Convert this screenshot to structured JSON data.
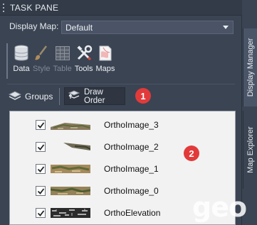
{
  "pane": {
    "title": "TASK PANE"
  },
  "display_map": {
    "label": "Display Map:",
    "value": "Default"
  },
  "toolbar": {
    "items": [
      {
        "label": "Data",
        "icon": "database-icon",
        "enabled": true
      },
      {
        "label": "Style",
        "icon": "paintbrush-icon",
        "enabled": false
      },
      {
        "label": "Table",
        "icon": "table-icon",
        "enabled": false
      },
      {
        "label": "Tools",
        "icon": "tools-icon",
        "enabled": true
      },
      {
        "label": "Maps",
        "icon": "maps-icon",
        "enabled": true
      }
    ]
  },
  "view_buttons": {
    "groups": "Groups",
    "draw_order": "Draw Order"
  },
  "callouts": {
    "one": "1",
    "two": "2"
  },
  "layers": [
    {
      "label": "OrthoImage_3",
      "checked": true
    },
    {
      "label": "OrthoImage_2",
      "checked": true
    },
    {
      "label": "OrthoImage_1",
      "checked": true
    },
    {
      "label": "OrthoImage_0",
      "checked": true
    },
    {
      "label": "OrthoElevation",
      "checked": true
    }
  ],
  "side_tabs": {
    "display_manager": "Display Manager",
    "map_explorer": "Map Explorer"
  },
  "watermark": "geo",
  "colors": {
    "callout": "#e23a3a",
    "panel_bg": "#3b4453",
    "list_bg": "#f2f2f2"
  }
}
